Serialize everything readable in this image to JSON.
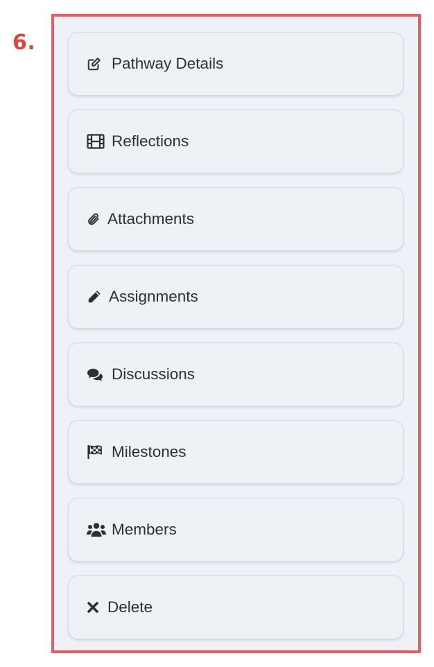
{
  "step": {
    "label": "6.",
    "color": "#d9473f"
  },
  "panel": {
    "border_color": "#e35d64",
    "background": "#eef1f6"
  },
  "menu": {
    "items": [
      {
        "label": "Pathway Details",
        "icon": "edit-icon"
      },
      {
        "label": "Reflections",
        "icon": "film-icon"
      },
      {
        "label": "Attachments",
        "icon": "paperclip-icon"
      },
      {
        "label": "Assignments",
        "icon": "pencil-icon"
      },
      {
        "label": "Discussions",
        "icon": "comments-icon"
      },
      {
        "label": "Milestones",
        "icon": "flag-checkered-icon"
      },
      {
        "label": "Members",
        "icon": "users-icon"
      },
      {
        "label": "Delete",
        "icon": "times-icon"
      }
    ]
  }
}
